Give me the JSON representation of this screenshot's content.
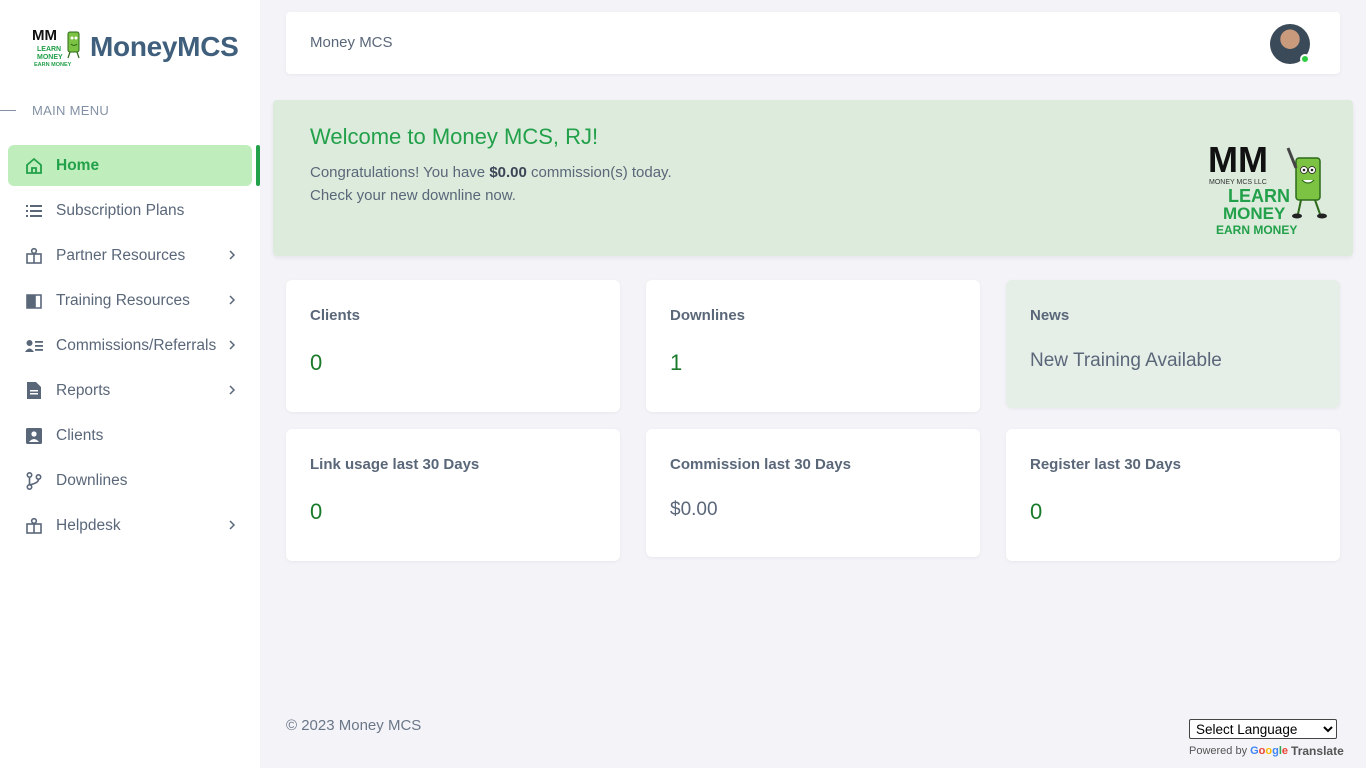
{
  "brand": {
    "name": "MoneyMCS",
    "logo_text": "MM LEARN MONEY EARN MONEY"
  },
  "sidebar": {
    "menu_title": "MAIN MENU",
    "items": [
      {
        "label": "Home",
        "icon": "home-icon",
        "active": true,
        "submenu": false
      },
      {
        "label": "Subscription Plans",
        "icon": "list-icon",
        "active": false,
        "submenu": false
      },
      {
        "label": "Partner Resources",
        "icon": "resources-icon",
        "active": false,
        "submenu": true
      },
      {
        "label": "Training Resources",
        "icon": "book-icon",
        "active": false,
        "submenu": true
      },
      {
        "label": "Commissions/Referrals",
        "icon": "users-list-icon",
        "active": false,
        "submenu": true
      },
      {
        "label": "Reports",
        "icon": "document-icon",
        "active": false,
        "submenu": true
      },
      {
        "label": "Clients",
        "icon": "contact-icon",
        "active": false,
        "submenu": false
      },
      {
        "label": "Downlines",
        "icon": "branch-icon",
        "active": false,
        "submenu": false
      },
      {
        "label": "Helpdesk",
        "icon": "resources-icon",
        "active": false,
        "submenu": true
      }
    ]
  },
  "topbar": {
    "title": "Money MCS"
  },
  "welcome": {
    "title": "Welcome to Money MCS, RJ!",
    "line1_prefix": "Congratulations! You have ",
    "line1_amount": "$0.00",
    "line1_suffix": " commission(s) today.",
    "line2": "Check your new downline now.",
    "logo_text": {
      "mm": "MM",
      "sub": "MONEY MCS LLC",
      "learn": "LEARN",
      "money": "MONEY",
      "earn": "EARN MONEY"
    }
  },
  "cards": [
    {
      "label": "Clients",
      "value": "0"
    },
    {
      "label": "Downlines",
      "value": "1"
    },
    {
      "label": "News",
      "value": "New Training Available"
    },
    {
      "label": "Link usage last 30 Days",
      "value": "0"
    },
    {
      "label": "Commission last 30 Days",
      "value": "$0.00"
    },
    {
      "label": "Register last 30 Days",
      "value": "0"
    }
  ],
  "footer": {
    "copyright": "© 2023 Money MCS",
    "language_select": "Select Language",
    "powered_by": "Powered by",
    "google": "Google",
    "translate": "Translate"
  },
  "colors": {
    "accent": "#22a04a",
    "active_bg": "#bfeebc",
    "welcome_bg": "#dcebdc",
    "value_green": "#1a7a2b"
  }
}
